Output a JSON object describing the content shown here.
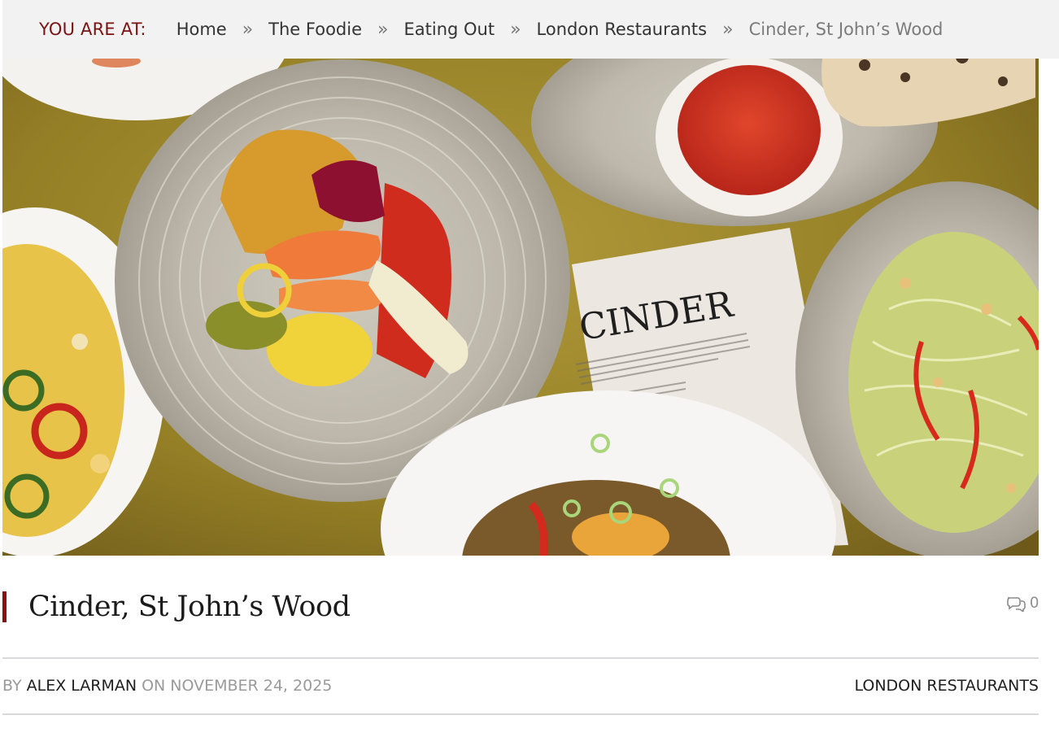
{
  "breadcrumb": {
    "prefix": "YOU ARE AT:",
    "separator": "»",
    "items": [
      "Home",
      "The Foodie",
      "Eating Out",
      "London Restaurants"
    ],
    "current": "Cinder, St John’s Wood"
  },
  "hero": {
    "menu_card_heading": "CINDER",
    "description": "overhead food photo of plates on a gold table"
  },
  "article": {
    "title": "Cinder, St John’s Wood",
    "comment_count": "0",
    "byline_prefix": "BY",
    "author": "ALEX LARMAN",
    "date_prefix": "ON",
    "date": "NOVEMBER 24, 2025",
    "category": "LONDON RESTAURANTS"
  },
  "colors": {
    "accent": "#8b0f12",
    "breadcrumb_bg": "#f2f2f3",
    "table_gold": "#9a8427"
  },
  "icons": {
    "comments": "speech-bubbles-icon"
  }
}
